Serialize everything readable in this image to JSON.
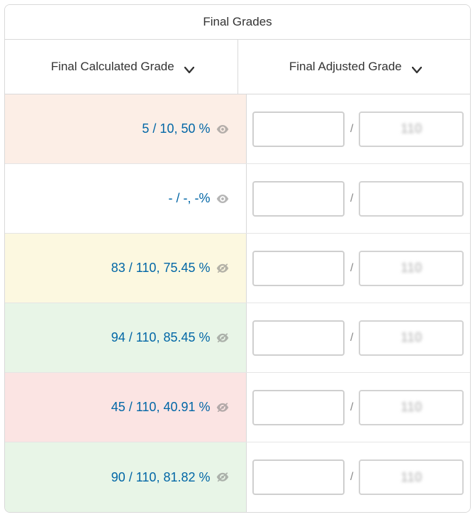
{
  "header": {
    "title": "Final Grades"
  },
  "columns": {
    "calculated": "Final Calculated Grade",
    "adjusted": "Final Adjusted Grade"
  },
  "rows": [
    {
      "grade_text": "5 / 10, 50 %",
      "bg": "bg-orange",
      "visible": true,
      "denom": "110"
    },
    {
      "grade_text": "- / -, -%",
      "bg": "bg-white",
      "visible": true,
      "denom": ""
    },
    {
      "grade_text": "83 / 110, 75.45 %",
      "bg": "bg-yellow",
      "visible": false,
      "denom": "110"
    },
    {
      "grade_text": "94 / 110, 85.45 %",
      "bg": "bg-green",
      "visible": false,
      "denom": "110"
    },
    {
      "grade_text": "45 / 110, 40.91 %",
      "bg": "bg-red",
      "visible": false,
      "denom": "110"
    },
    {
      "grade_text": "90 / 110, 81.82 %",
      "bg": "bg-green",
      "visible": false,
      "denom": "110"
    }
  ],
  "glyphs": {
    "slash": "/"
  }
}
